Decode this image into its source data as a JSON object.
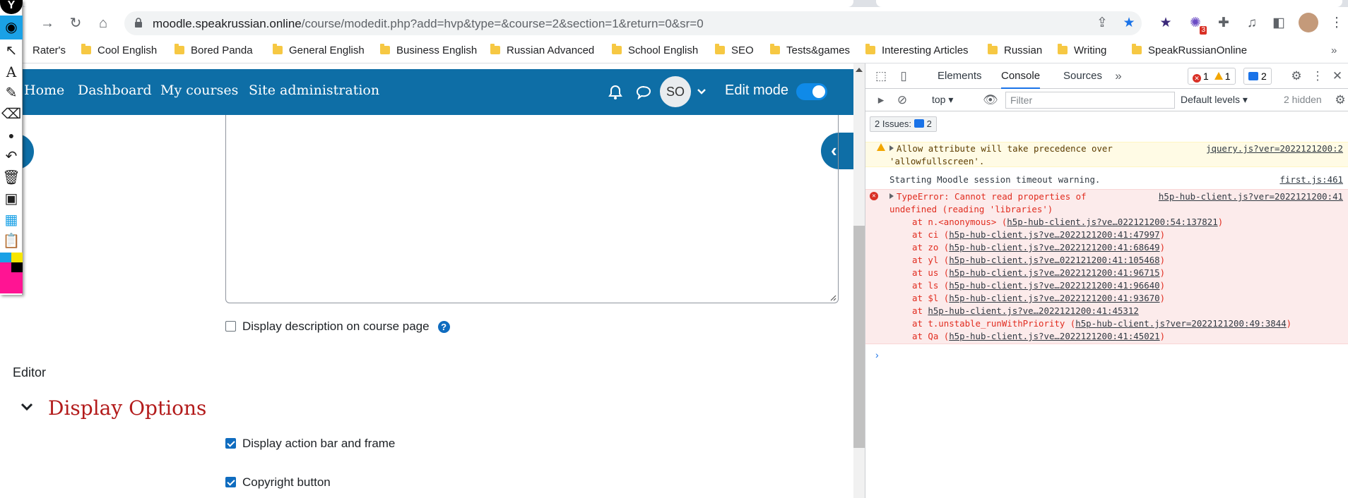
{
  "browser": {
    "url_host": "moodle.speakrussian.online",
    "url_path": "/course/modedit.php?add=hvp&type=&course=2&section=1&return=0&sr=0",
    "extension_badge": "3",
    "bookmarks": [
      "Rater's",
      "Cool English",
      "Bored Panda",
      "General English",
      "Business English",
      "Russian Advanced",
      "School English",
      "SEO",
      "Tests&games",
      "Interesting Articles",
      "Russian",
      "Writing",
      "SpeakRussianOnline"
    ]
  },
  "moodle": {
    "nav": {
      "home": "Home",
      "dashboard": "Dashboard",
      "my_courses": "My courses",
      "site_admin": "Site administration"
    },
    "avatar_initials": "SO",
    "edit_mode_label": "Edit mode",
    "edit_mode_on": true,
    "display_description_label": "Display description on course page",
    "display_description_checked": false,
    "help_glyph": "?",
    "editor_label": "Editor",
    "display_options_heading": "Display Options",
    "action_bar_label": "Display action bar and frame",
    "action_bar_checked": true,
    "copyright_label": "Copyright button",
    "copyright_checked": true
  },
  "devtools": {
    "tabs": [
      "Elements",
      "Console",
      "Sources"
    ],
    "active_tab": "Console",
    "error_count": "1",
    "warning_count": "1",
    "message_count": "2",
    "context": "top",
    "filter_placeholder": "Filter",
    "levels": "Default levels",
    "hidden": "2 hidden",
    "issues_label": "2 Issues:",
    "issues_count": "2",
    "console": {
      "warn_line1": "Allow attribute will take precedence over",
      "warn_line2": "'allowfullscreen'.",
      "warn_src": "jquery.js?ver=2022121200:2",
      "info_text": "Starting Moodle session timeout warning.",
      "info_src": "first.js:461",
      "err_line1": "TypeError: Cannot read properties of",
      "err_line2": "undefined (reading 'libraries')",
      "err_src": "h5p-hub-client.js?ver=2022121200:41",
      "stack": [
        {
          "fn": "at n.<anonymous> (",
          "link": "h5p-hub-client.js?ve…022121200:54:137821",
          "end": ")"
        },
        {
          "fn": "at ci (",
          "link": "h5p-hub-client.js?ve…2022121200:41:47997",
          "end": ")"
        },
        {
          "fn": "at zo (",
          "link": "h5p-hub-client.js?ve…2022121200:41:68649",
          "end": ")"
        },
        {
          "fn": "at yl (",
          "link": "h5p-hub-client.js?ve…022121200:41:105468",
          "end": ")"
        },
        {
          "fn": "at us (",
          "link": "h5p-hub-client.js?ve…2022121200:41:96715",
          "end": ")"
        },
        {
          "fn": "at ls (",
          "link": "h5p-hub-client.js?ve…2022121200:41:96640",
          "end": ")"
        },
        {
          "fn": "at $l (",
          "link": "h5p-hub-client.js?ve…2022121200:41:93670",
          "end": ")"
        },
        {
          "fn": "at ",
          "link": "h5p-hub-client.js?ve…2022121200:41:45312",
          "end": ""
        },
        {
          "fn": "at t.unstable_runWithPriority (",
          "link": "h5p-hub-client.js?ver=2022121200:49:3844",
          "end": ")"
        },
        {
          "fn": "at Qa (",
          "link": "h5p-hub-client.js?ve…2022121200:41:45021",
          "end": ")"
        }
      ]
    }
  },
  "colors": {
    "moodle_nav": "#0e6ea6",
    "heading_red": "#b31b1b",
    "checkbox_blue": "#0f6cbf",
    "devtools_accent": "#1a73e8",
    "error_red": "#e12c1f"
  },
  "annotation_tools": [
    "eye-icon",
    "cursor-icon",
    "text-icon",
    "pen-icon",
    "eraser-icon",
    "dot-icon",
    "undo-icon",
    "trash-icon",
    "presentation-icon",
    "camera-icon",
    "clipboard-icon"
  ]
}
